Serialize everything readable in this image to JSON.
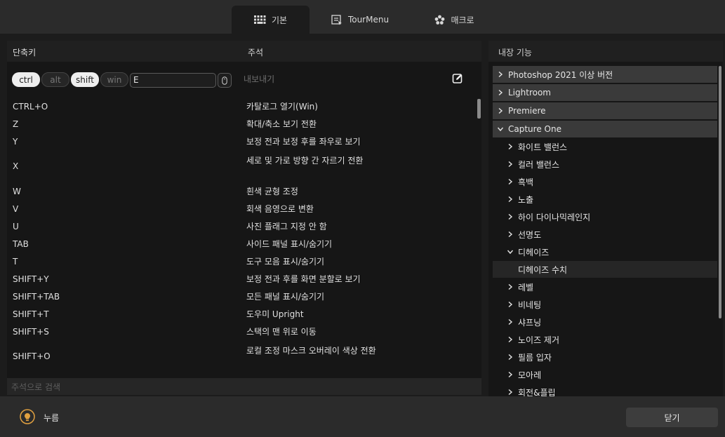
{
  "tabs": [
    {
      "label": "기본",
      "icon": "keyboard-icon"
    },
    {
      "label": "TourMenu",
      "icon": "menu-list-icon"
    },
    {
      "label": "매크로",
      "icon": "flower-icon"
    }
  ],
  "shortcuts": {
    "column_key": "단축키",
    "column_comment": "주석",
    "editor": {
      "modifiers": [
        {
          "label": "ctrl",
          "active": true
        },
        {
          "label": "alt",
          "active": false
        },
        {
          "label": "shift",
          "active": true
        },
        {
          "label": "win",
          "active": false
        }
      ],
      "key_value": "E",
      "comment_placeholder": "내보내기"
    },
    "rows": [
      {
        "key": "CTRL+O",
        "comment": "카탈로그 열기(Win)"
      },
      {
        "key": "Z",
        "comment": "확대/축소 보기 전환"
      },
      {
        "key": "Y",
        "comment": "보정 전과 보정 후를 좌우로 보기"
      },
      {
        "key": "X",
        "comment": "세로 및 가로 방향 간 자르기 전환"
      },
      {
        "key": "W",
        "comment": "흰색 균형 조정"
      },
      {
        "key": "V",
        "comment": "회색 음영으로 변환"
      },
      {
        "key": "U",
        "comment": "사진 플래그 지정 안 함"
      },
      {
        "key": "TAB",
        "comment": "사이드 패널 표시/숨기기"
      },
      {
        "key": "T",
        "comment": "도구 모음 표시/숨기기"
      },
      {
        "key": "SHIFT+Y",
        "comment": "보정 전과 후를 화면 분할로 보기"
      },
      {
        "key": "SHIFT+TAB",
        "comment": "모든 패널 표시/숨기기"
      },
      {
        "key": "SHIFT+T",
        "comment": "도우미 Upright"
      },
      {
        "key": "SHIFT+S",
        "comment": "스택의 맨 위로 이동"
      },
      {
        "key": "SHIFT+O",
        "comment": "로컬 조정 마스크 오버레이 색상 전환"
      }
    ],
    "search_placeholder": "주석으로 검색"
  },
  "builtin": {
    "title": "내장 기능",
    "groups": [
      {
        "label": "Photoshop 2021 이상 버전",
        "expanded": false
      },
      {
        "label": "Lightroom",
        "expanded": false
      },
      {
        "label": "Premiere",
        "expanded": false
      },
      {
        "label": "Capture One",
        "expanded": true
      }
    ],
    "children": [
      {
        "label": "화이트 밸런스",
        "expanded": false
      },
      {
        "label": "컬러 밸런스",
        "expanded": false
      },
      {
        "label": "흑백",
        "expanded": false
      },
      {
        "label": "노출",
        "expanded": false
      },
      {
        "label": "하이 다이나믹레인지",
        "expanded": false
      },
      {
        "label": "선명도",
        "expanded": false
      },
      {
        "label": "디헤이즈",
        "expanded": true
      },
      {
        "label": "디헤이즈 수치",
        "leaf": true
      },
      {
        "label": "레벨",
        "expanded": false
      },
      {
        "label": "비네팅",
        "expanded": false
      },
      {
        "label": "샤프닝",
        "expanded": false
      },
      {
        "label": "노이즈 제거",
        "expanded": false
      },
      {
        "label": "필름 입자",
        "expanded": false
      },
      {
        "label": "모아레",
        "expanded": false
      },
      {
        "label": "회전&플립",
        "expanded": false
      }
    ]
  },
  "footer": {
    "press_label": "누름",
    "close_label": "닫기"
  }
}
